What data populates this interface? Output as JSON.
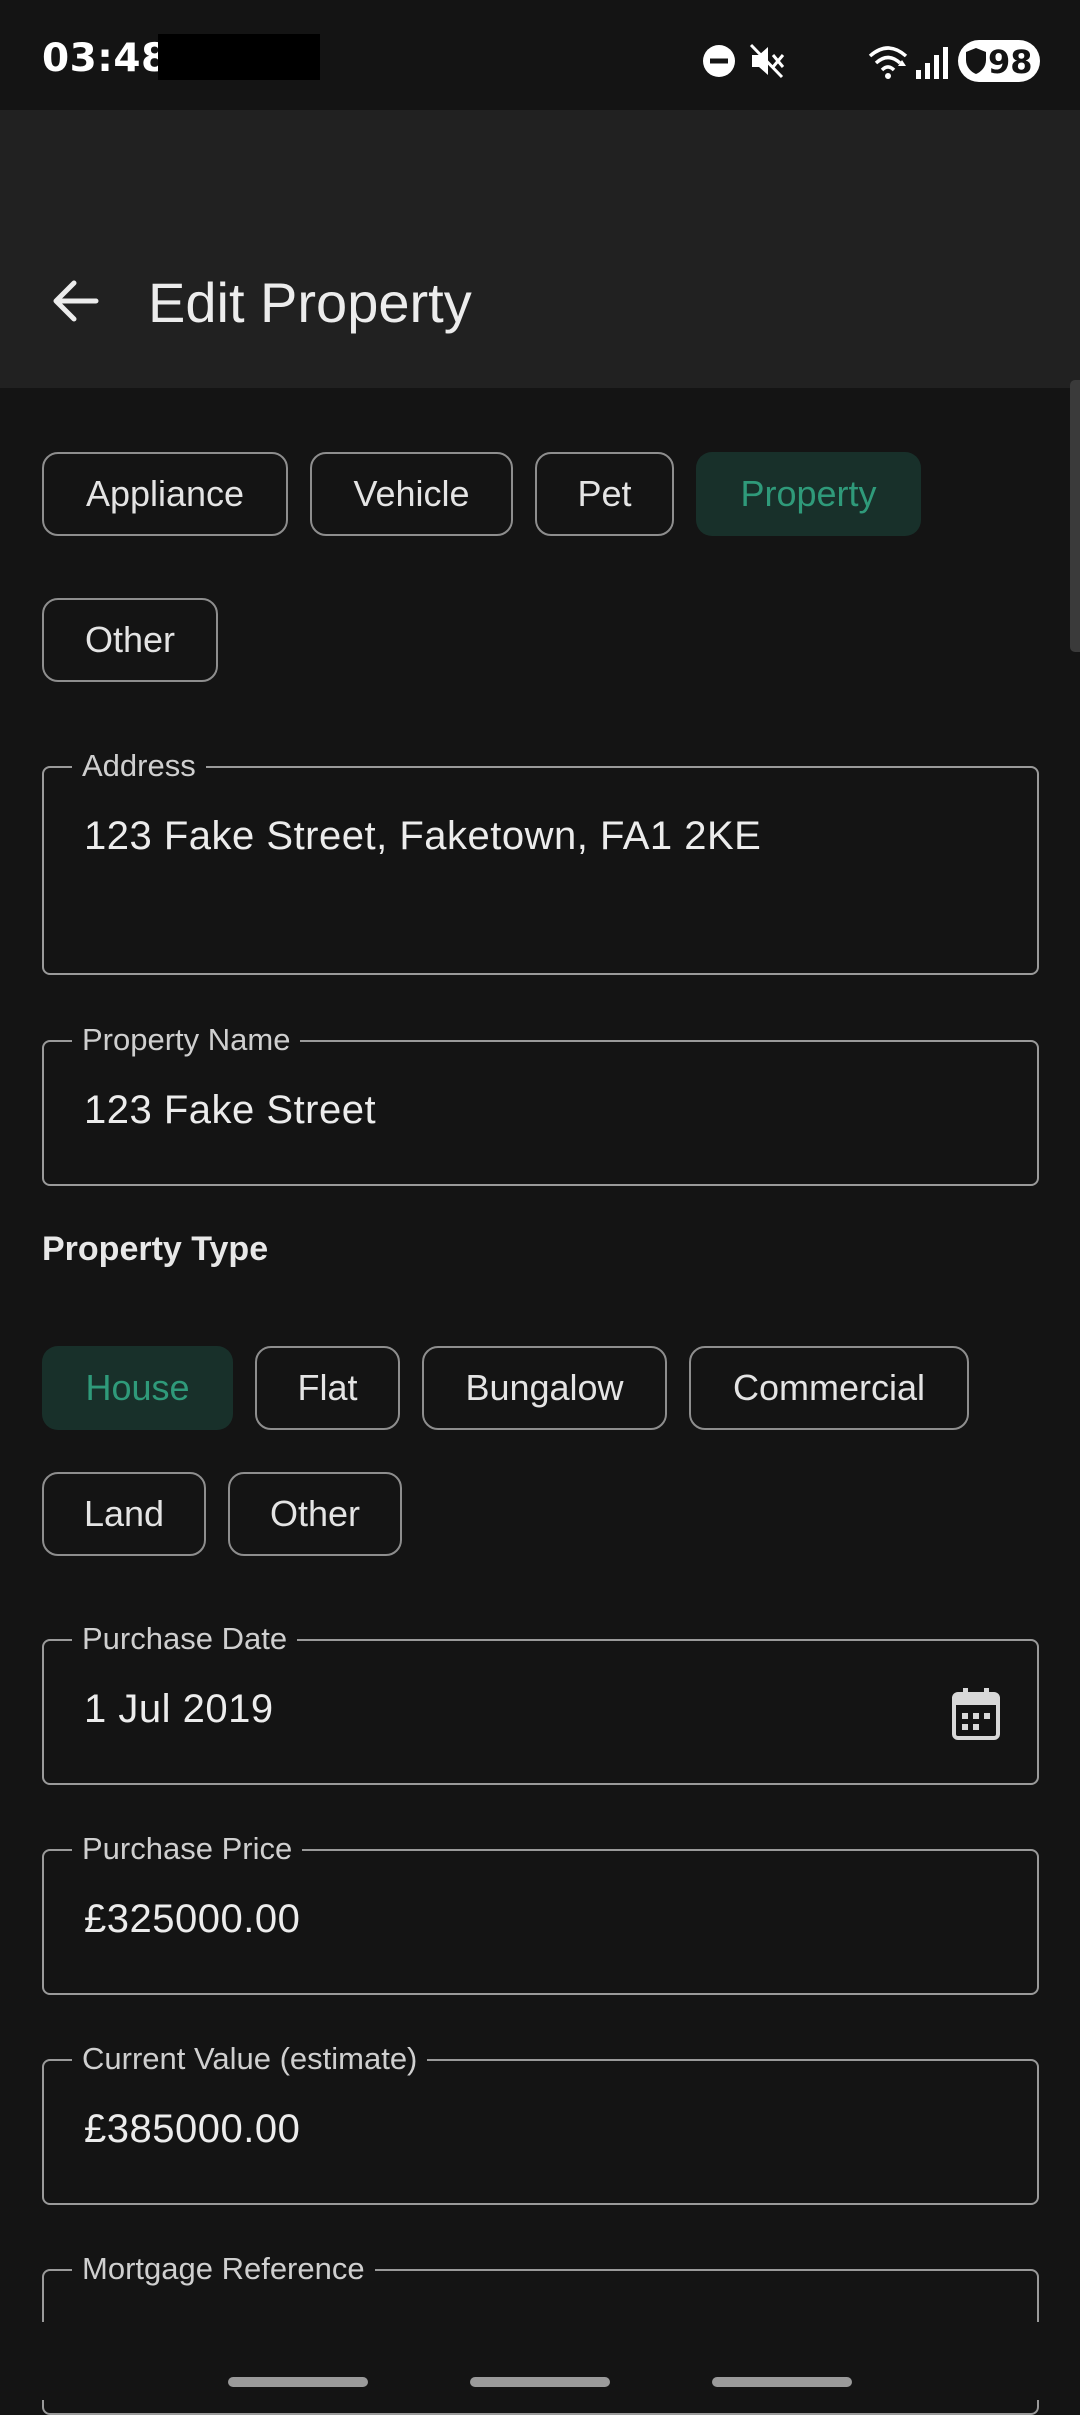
{
  "status": {
    "time": "03:48",
    "battery": "98"
  },
  "app_bar": {
    "title": "Edit Property"
  },
  "categories": [
    {
      "label": "Appliance",
      "selected": false
    },
    {
      "label": "Vehicle",
      "selected": false
    },
    {
      "label": "Pet",
      "selected": false
    },
    {
      "label": "Property",
      "selected": true
    },
    {
      "label": "Other",
      "selected": false
    }
  ],
  "fields": {
    "address": {
      "label": "Address",
      "value": "123 Fake Street, Faketown, FA1 2KE"
    },
    "property_name": {
      "label": "Property Name",
      "value": "123 Fake Street"
    },
    "purchase_date": {
      "label": "Purchase Date",
      "value": "1 Jul 2019"
    },
    "purchase_price": {
      "label": "Purchase Price",
      "currency": "£",
      "value": "325000.00"
    },
    "current_value": {
      "label": "Current Value (estimate)",
      "currency": "£",
      "value": "385000.00"
    },
    "mortgage_reference": {
      "label": "Mortgage Reference",
      "value": ""
    }
  },
  "property_type": {
    "label": "Property Type",
    "options": [
      {
        "label": "House",
        "selected": true
      },
      {
        "label": "Flat",
        "selected": false
      },
      {
        "label": "Bungalow",
        "selected": false
      },
      {
        "label": "Commercial",
        "selected": false
      },
      {
        "label": "Land",
        "selected": false
      },
      {
        "label": "Other",
        "selected": false
      }
    ]
  },
  "colors": {
    "background": "#141414",
    "app_bar": "#212121",
    "selected_chip_bg": "#18302a",
    "selected_chip_text": "#2f9a7a"
  },
  "icons": {
    "back": "arrow-back-icon",
    "calendar": "calendar-icon",
    "dnd": "do-not-disturb-icon",
    "mute": "vibrate-mute-icon",
    "wifi": "wifi-icon",
    "signal": "signal-icon",
    "battery": "battery-icon"
  }
}
